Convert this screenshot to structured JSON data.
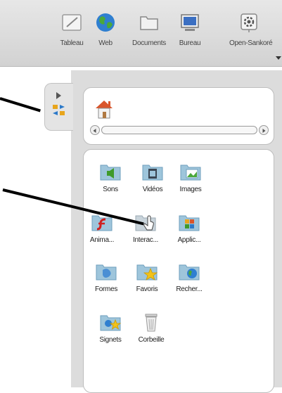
{
  "toolbar": {
    "items": [
      {
        "label": "Tableau",
        "icon": "whiteboard-icon"
      },
      {
        "label": "Web",
        "icon": "globe-icon"
      },
      {
        "label": "Documents",
        "icon": "folder-icon"
      },
      {
        "label": "Bureau",
        "icon": "monitor-icon"
      },
      {
        "label": "Open-Sankoré",
        "icon": "gear-icon"
      }
    ]
  },
  "library": {
    "items": [
      {
        "label": "Sons",
        "icon": "sound-folder-icon"
      },
      {
        "label": "Vidéos",
        "icon": "video-folder-icon"
      },
      {
        "label": "Images",
        "icon": "image-folder-icon"
      },
      {
        "label": "Anima...",
        "icon": "flash-folder-icon"
      },
      {
        "label": "Interac...",
        "icon": "interactive-folder-icon"
      },
      {
        "label": "Applic...",
        "icon": "app-folder-icon"
      },
      {
        "label": "Formes",
        "icon": "shape-folder-icon"
      },
      {
        "label": "Favoris",
        "icon": "star-folder-icon"
      },
      {
        "label": "Recher...",
        "icon": "search-folder-icon"
      },
      {
        "label": "Signets",
        "icon": "bookmark-folder-icon"
      },
      {
        "label": "Corbeille",
        "icon": "trash-icon"
      }
    ]
  },
  "colors": {
    "folder": "#9ec5db",
    "folder_dark": "#6f9fbd",
    "panel": "#dcdcdc",
    "home_roof": "#d9552b"
  }
}
